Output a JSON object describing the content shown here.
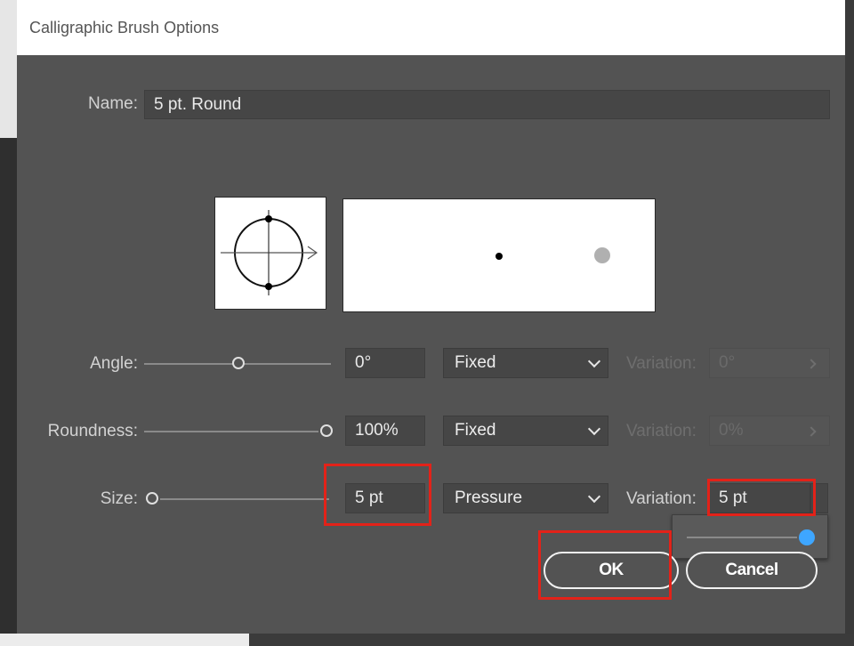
{
  "dialog": {
    "title": "Calligraphic Brush Options",
    "ok_label": "OK",
    "cancel_label": "Cancel"
  },
  "name": {
    "label": "Name:",
    "value": "5 pt. Round"
  },
  "angle": {
    "label": "Angle:",
    "value": "0°",
    "mode": "Fixed",
    "variation_label": "Variation:",
    "variation_value": "0°",
    "variation_enabled": false
  },
  "roundness": {
    "label": "Roundness:",
    "value": "100%",
    "mode": "Fixed",
    "variation_label": "Variation:",
    "variation_value": "0%",
    "variation_enabled": false
  },
  "size": {
    "label": "Size:",
    "value": "5 pt",
    "mode": "Pressure",
    "variation_label": "Variation:",
    "variation_value": "5 pt",
    "variation_enabled": true
  },
  "colors": {
    "dialog_bg": "#535353",
    "field_bg": "#464646",
    "highlight": "#e32219",
    "slider_accent": "#3ea6ff"
  },
  "icons": [
    "chevron-down-icon",
    "chevron-right-icon",
    "brush-angle-preview-icon"
  ]
}
